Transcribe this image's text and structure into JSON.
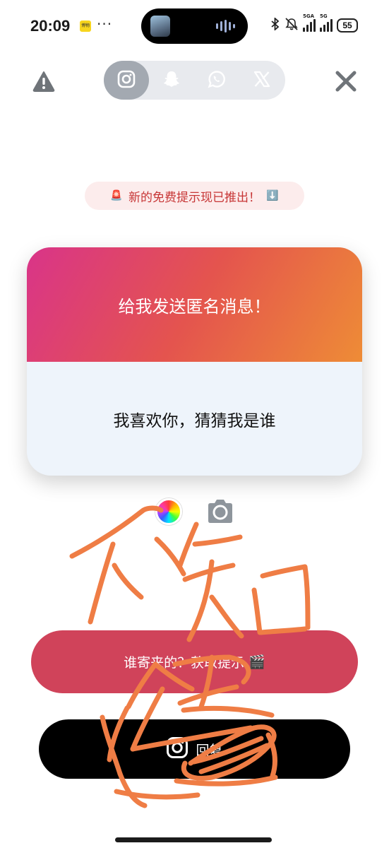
{
  "status_bar": {
    "time": "20:09",
    "notif_app_label": "博物",
    "more": "···",
    "network_1": "5GA",
    "network_2": "5G",
    "battery": "55"
  },
  "header": {
    "tabs": [
      {
        "icon": "instagram-icon",
        "active": true
      },
      {
        "icon": "snapchat-icon",
        "active": false
      },
      {
        "icon": "whatsapp-icon",
        "active": false
      },
      {
        "icon": "x-icon",
        "active": false
      }
    ]
  },
  "banner": {
    "prefix_emoji": "🚨",
    "text": "新的免费提示现已推出！",
    "suffix_emoji": "⬇️"
  },
  "card": {
    "title": "给我发送匿名消息！",
    "message": "我喜欢你，猜猜我是谁"
  },
  "hint_button": {
    "label": "谁寄来的？获取提示",
    "emoji": "🎬"
  },
  "reply_button": {
    "label": "回复"
  },
  "colors": {
    "hint_button": "#d0435a",
    "scribble": "#ef7d45",
    "banner_text": "#c73636"
  }
}
